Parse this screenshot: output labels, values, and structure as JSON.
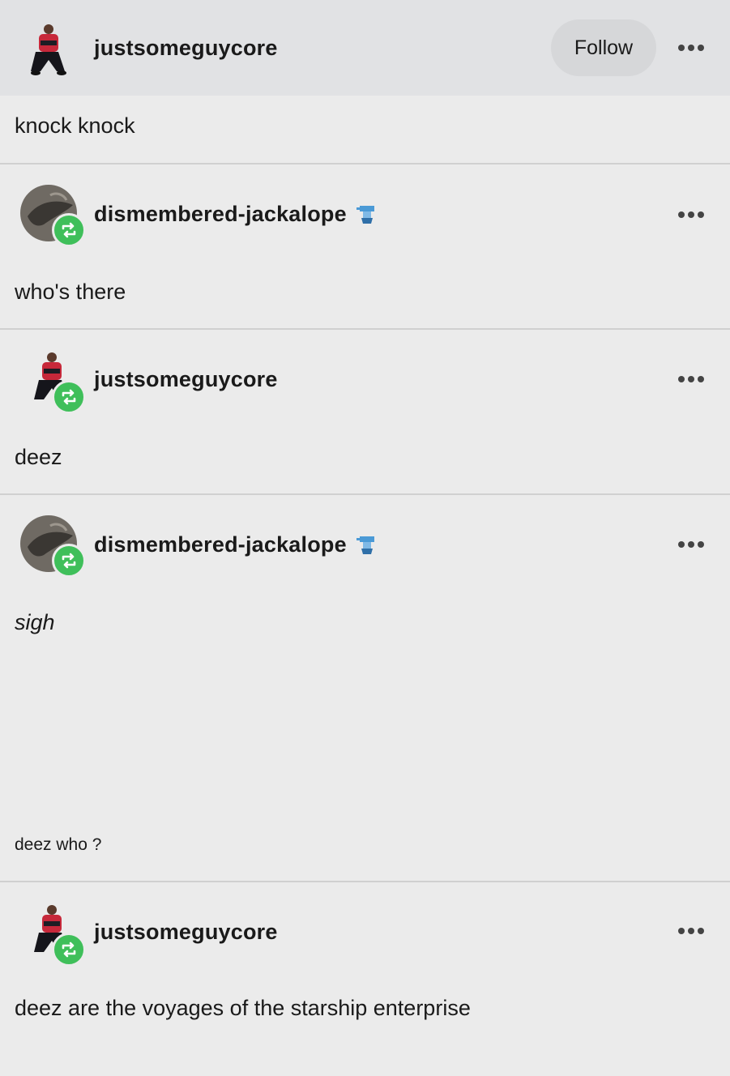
{
  "header": {
    "username": "justsomeguycore",
    "follow_label": "Follow"
  },
  "posts": [
    {
      "text": "knock knock"
    },
    {
      "username": "dismembered-jackalope",
      "text": "who's there"
    },
    {
      "username": "justsomeguycore",
      "text": "deez"
    },
    {
      "username": "dismembered-jackalope",
      "text": "sigh",
      "small_text": "deez who ?"
    },
    {
      "username": "justsomeguycore",
      "text": "deez are the voyages of the starship enterprise"
    }
  ],
  "icons": {
    "more": "more-dots-icon",
    "reblog": "reblog-icon",
    "badge": "blue-figure-badge-icon"
  },
  "colors": {
    "reblog_green": "#3fbf5a",
    "follow_button": "#d6d7d9",
    "header_bg": "#e1e2e4",
    "page_bg": "#ebebeb"
  }
}
